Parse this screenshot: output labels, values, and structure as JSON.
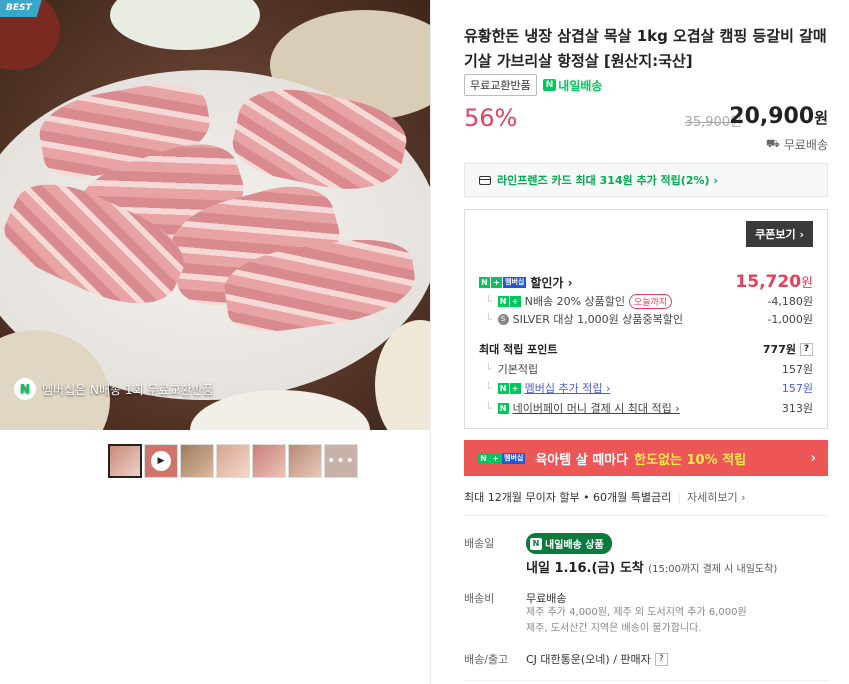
{
  "gallery": {
    "badge": "BEST",
    "caption": "멤버십은 N배송 1회 무료교환반품",
    "caption_icon": "N",
    "more_icon": "•••"
  },
  "product": {
    "title": "유황한돈 냉장 삼겹살 목살 1kg 오겹살 캠핑 등갈비 갈매기살 가브리살 항정살 [원산지:국산]",
    "chip_exchange": "무료교환반품",
    "chip_tomorrow": "내일배송",
    "discount": "56%",
    "original_price": "35,900원",
    "sale_price": "20,900",
    "won": "원",
    "shipping": "무료배송"
  },
  "card_offer": "라인프렌즈 카드 최대 314원 추가 적립(2%) ›",
  "benefits": {
    "coupon_button": "쿠폰보기 ›",
    "discount_label": "할인가 ›",
    "discount_price": "15,720",
    "discount_won": "원",
    "nplus_g": "N",
    "nplus_plus": "+",
    "nplus_b": "멤버십",
    "n_delivery_label": "N배송 20% 상품할인",
    "today_pill": "오늘까지",
    "n_delivery_val": "-4,180원",
    "silver_icon": "S",
    "silver_label": "SILVER 대상 1,000원 상품중복할인",
    "silver_val": "-1,000원",
    "points_label": "최대 적립 포인트",
    "points_val": "777원",
    "q_mark": "?",
    "base_label": "기본적립",
    "base_val": "157원",
    "membership_label": "멤버십 추가 적립 ›",
    "membership_val": "157원",
    "npay_label": "네이버페이 머니 결제 시 최대 적립 ›",
    "npay_val": "313원"
  },
  "promo": {
    "text": "육아템 살 때마다",
    "highlight": "한도없는 10% 적립",
    "arrow": "›"
  },
  "installment": {
    "text": "최대 12개월 무이자 할부 • 60개월 특별금리",
    "more": "자세히보기 ›"
  },
  "delivery": {
    "date_label": "배송일",
    "pill": "내일배송 상품",
    "arrival": "내일 1.16.(금) 도착",
    "arrival_note": "(15:00까지 결제 시 내일도착)",
    "fee_label": "배송비",
    "fee": "무료배송",
    "fee_note1": "제주 추가 4,000원, 제주 외 도서지역 추가 6,000원",
    "fee_note2": "제주, 도서산간 지역은 배송이 불가합니다.",
    "ship_label": "배송/출고",
    "ship_val": "CJ 대한통운(오네) / 판매자"
  },
  "colors": {
    "discount_red": "#e5405e",
    "naver_green": "#03c75a",
    "promo_red": "#ec5656"
  }
}
